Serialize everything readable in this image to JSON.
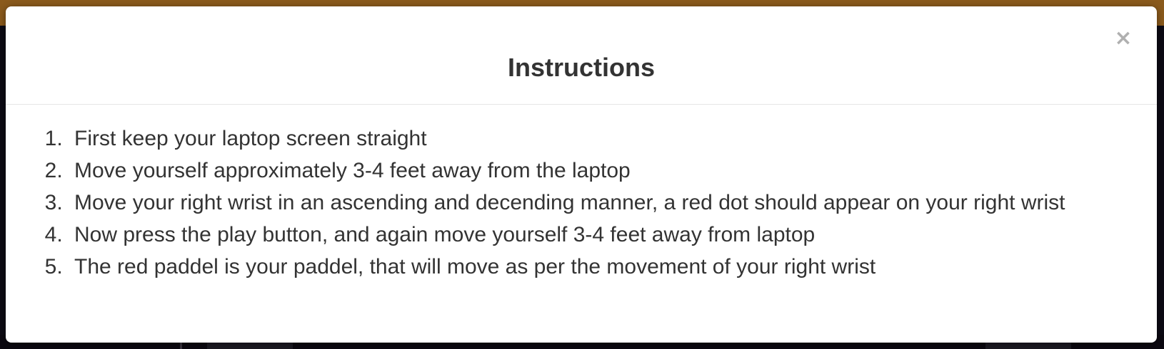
{
  "dialog": {
    "title": "Instructions",
    "close_label": "×",
    "instructions": [
      "First keep your laptop screen straight",
      "Move yourself approximately 3-4 feet away from the laptop",
      "Move your right wrist in an ascending and decending manner, a red dot should appear on your right wrist",
      "Now press the play button, and again move yourself 3-4 feet away from laptop",
      "The red paddel is your paddel, that will move as per the movement of your right wrist"
    ]
  },
  "colors": {
    "header_band": "#8a5a1c",
    "backdrop": "#0c0a14",
    "modal_background": "#ffffff",
    "text": "#333333",
    "close_icon": "#b0b0b0"
  }
}
